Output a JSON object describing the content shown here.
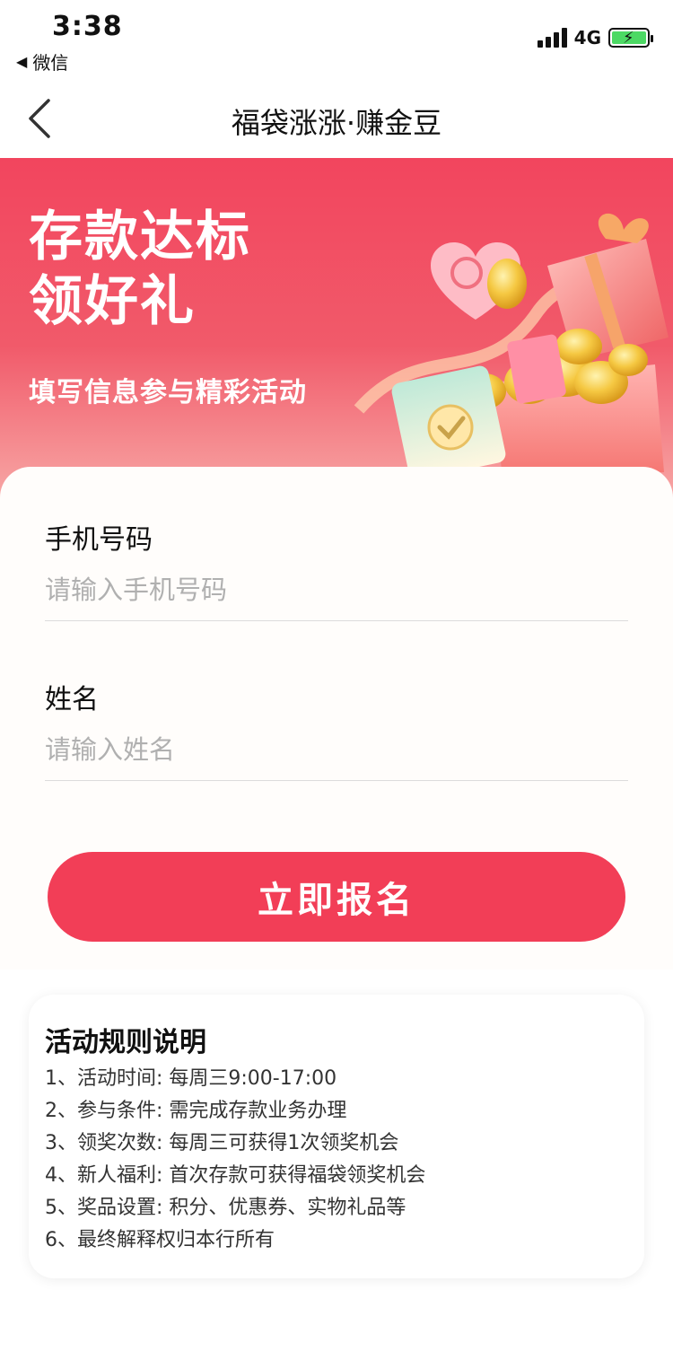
{
  "status_bar": {
    "time": "3:38",
    "back_app": "微信",
    "network": "4G"
  },
  "nav": {
    "title": "福袋涨涨·赚金豆"
  },
  "banner": {
    "title_line1": "存款达标",
    "title_line2": "领好礼",
    "subtitle": "填写信息参与精彩活动"
  },
  "form": {
    "phone_label": "手机号码",
    "phone_placeholder": "请输入手机号码",
    "phone_value": "",
    "name_label": "姓名",
    "name_placeholder": "请输入姓名",
    "name_value": "",
    "submit_label": "立即报名"
  },
  "rules": {
    "title": "活动规则说明",
    "items": [
      "1、活动时间: 每周三9:00-17:00",
      "2、参与条件: 需完成存款业务办理",
      "3、领奖次数: 每周三可获得1次领奖机会",
      "4、新人福利: 首次存款可获得福袋领奖机会",
      "5、奖品设置: 积分、优惠券、实物礼品等",
      "6、最终解释权归本行所有"
    ]
  },
  "colors": {
    "brand_red": "#f23e57",
    "banner_top": "#f2455e",
    "gold": "#f5c842"
  }
}
